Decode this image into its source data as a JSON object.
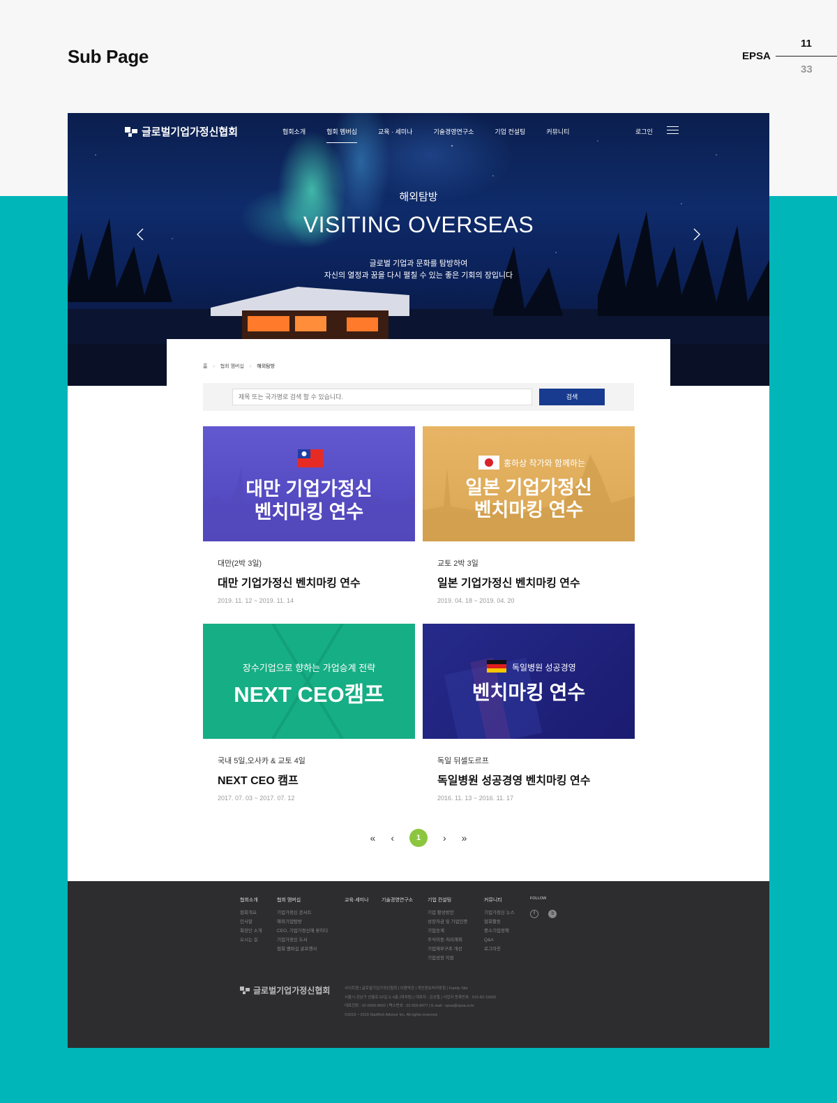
{
  "deck": {
    "title": "Sub Page",
    "brand": "EPSA",
    "page": "11",
    "total": "33"
  },
  "header": {
    "logo_text": "글로벌기업가정신협회",
    "nav": [
      "협회소개",
      "협회 멤버십",
      "교육 · 세미나",
      "기술경영연구소",
      "기업 컨설팅",
      "커뮤니티"
    ],
    "active_nav": "협회 멤버십",
    "login": "로그인"
  },
  "hero": {
    "subtitle_ko": "해외탐방",
    "title_en": "VISITING OVERSEAS",
    "desc_line1": "글로벌 기업과 문화를 탐방하여",
    "desc_line2": "자신의 열정과 꿈을 다시 펼칠 수 있는 좋은 기회의 장입니다"
  },
  "breadcrumb": [
    "홈",
    "협회 멤버십",
    "해외탐방"
  ],
  "search": {
    "placeholder": "제목 또는 국가명로 검색 할 수 있습니다.",
    "button": "검색"
  },
  "cards": [
    {
      "thumb_line1": "대만 기업가정신",
      "thumb_line2": "벤치마킹 연수",
      "thumb_bg": "#5b4fc9",
      "sub": "대만(2박 3일)",
      "title": "대만 기업가정신 벤치마킹 연수",
      "date": "2019. 11. 12 ~ 2019. 11. 14"
    },
    {
      "thumb_tag": "홍하상 작가와 함께하는",
      "thumb_line1": "일본 기업가정신",
      "thumb_line2": "벤치마킹 연수",
      "thumb_bg": "#e0ad5a",
      "sub": "교토 2박 3일",
      "title": "일본 기업가정신 벤치마킹 연수",
      "date": "2019. 04. 18 ~ 2019. 04. 20"
    },
    {
      "thumb_tag": "장수기업으로 향하는 가업승계 전략",
      "thumb_line1": "NEXT CEO캠프",
      "thumb_bg": "#16ae84",
      "sub": "국내 5일,오사카 & 교토 4일",
      "title": "NEXT CEO 캠프",
      "date": "2017. 07. 03 ~ 2017. 07. 12"
    },
    {
      "thumb_tag": "독일병원 성공경영",
      "thumb_line1": "벤치마킹 연수",
      "thumb_bg": "#1e1f7a",
      "sub": "독일 뒤셀도르프",
      "title": "독일병원 성공경영 벤치마킹 연수",
      "date": "2016. 11. 13 ~ 2016. 11. 17"
    }
  ],
  "pager": {
    "first": "«",
    "prev": "‹",
    "current": "1",
    "next": "›",
    "last": "»"
  },
  "footer": {
    "cols": [
      {
        "head": "협회소개",
        "items": [
          "협회개요",
          "인사말",
          "회장단 소개",
          "오시는 길"
        ]
      },
      {
        "head": "협회 멤버십",
        "items": [
          "기업가정신 콘서트",
          "해외기업탐방",
          "CEO, 기업가정신에 꽂히다",
          "기업가정신 도서",
          "협회 멤버십 골프행사"
        ]
      },
      {
        "head": "교육·세미나",
        "items": []
      },
      {
        "head": "기술경영연구소",
        "items": []
      },
      {
        "head": "기업 컨설팅",
        "items": [
          "기업 활성방안",
          "성장자금 및 기업인증",
          "기업승계",
          "주식이동·처리계획",
          "기업재무구조 개선",
          "기업성장 지원"
        ]
      },
      {
        "head": "커뮤니티",
        "items": [
          "기업가정신 뉴스",
          "협회활동",
          "중소기업정책",
          "Q&A",
          "로그아웃"
        ]
      },
      {
        "head": "FOLLOW",
        "items": []
      }
    ],
    "logo_text": "글로벌기업가정신협회",
    "info": [
      "사이트맵 | 글로벌기업가정신협회 | 이용약관 | 개인정보처리방침 | Family Site",
      "서울시 강남구 선릉로 62길 3, 6층 (대치동) | 대표자 : 김상철 | 사업자 등록번호 : 515-82-19430",
      "대표전화 : 02-6669-8662 | 팩스번호 : 02-556-8477 | E-mail : epsa@epsa.or.kr",
      "©2018 ~ 2019 StarRich Advisor Inc. All rights reserved."
    ]
  },
  "colors": {
    "teal": "#00b6b9",
    "navy_button": "#183b8f",
    "pager_active": "#8cc63f",
    "footer_bg": "#2d2d2f"
  }
}
